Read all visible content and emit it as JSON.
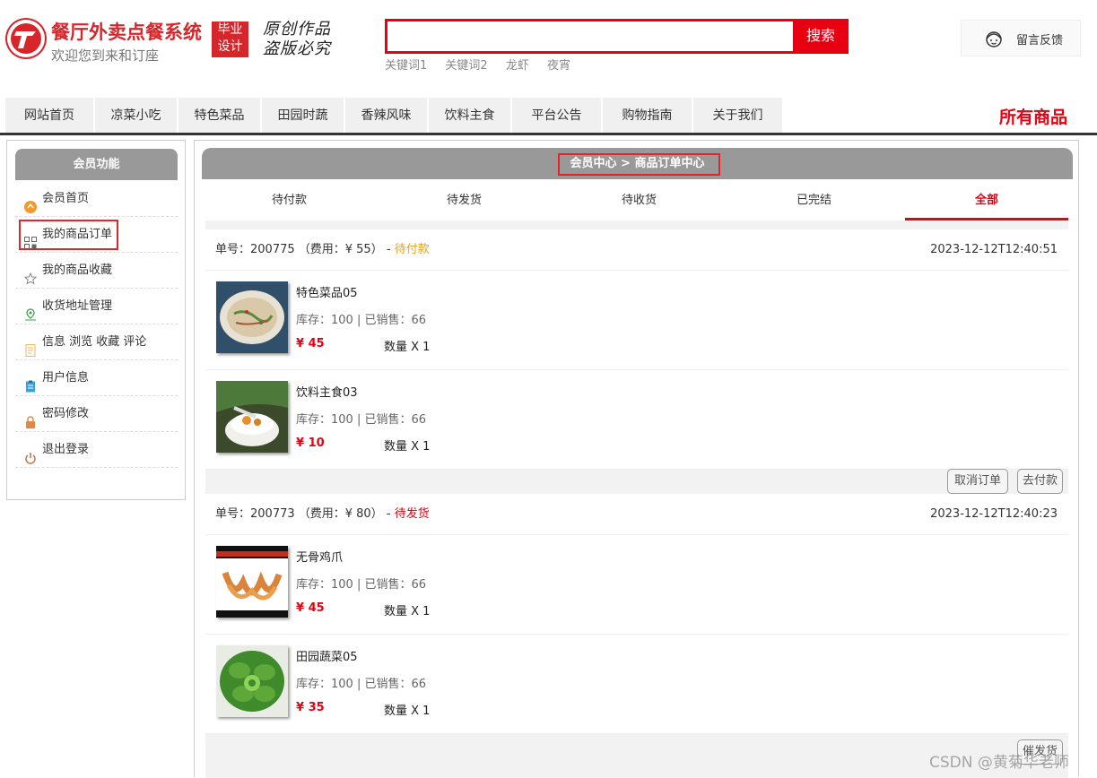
{
  "header": {
    "site_title": "餐厅外卖点餐系统",
    "site_subtitle": "欢迎您到来和订座",
    "badge_line1": "毕业",
    "badge_line2": "设计",
    "seal_line1": "原创作品",
    "seal_line2": "盗版必究",
    "search_placeholder": "",
    "search_button": "搜索",
    "keywords": [
      "关键词1",
      "关键词2",
      "龙虾",
      "夜宵"
    ],
    "feedback_label": "留言反馈"
  },
  "nav": {
    "items": [
      "网站首页",
      "凉菜小吃",
      "特色菜品",
      "田园时蔬",
      "香辣风味",
      "饮料主食",
      "平台公告",
      "购物指南",
      "关于我们"
    ],
    "all_goods": "所有商品"
  },
  "sidebar": {
    "title": "会员功能",
    "items": [
      {
        "label": "会员首页",
        "icon": "member-home-icon",
        "color": "#f39a2a"
      },
      {
        "label": "我的商品订单",
        "icon": "order-grid-icon",
        "color": "#666666"
      },
      {
        "label": "我的商品收藏",
        "icon": "star-icon",
        "color": "#888888"
      },
      {
        "label": "收货地址管理",
        "icon": "location-icon",
        "color": "#3aa34a"
      },
      {
        "label": "信息 浏览 收藏 评论",
        "icon": "document-icon",
        "color": "#f0b860"
      },
      {
        "label": "用户信息",
        "icon": "clipboard-icon",
        "color": "#3aa0d8"
      },
      {
        "label": "密码修改",
        "icon": "lock-icon",
        "color": "#e0874a"
      },
      {
        "label": "退出登录",
        "icon": "power-icon",
        "color": "#c07a5a"
      }
    ]
  },
  "main": {
    "breadcrumb": "会员中心 > 商品订单中心",
    "tabs": [
      "待付款",
      "待发货",
      "待收货",
      "已完结",
      "全部"
    ],
    "active_tab": "全部",
    "orders": [
      {
        "number": "单号：200775 （费用：¥ 55）",
        "sep": " - ",
        "status": "待付款",
        "time": "2023-12-12T12:40:51",
        "items": [
          {
            "name": "特色菜品05",
            "stock": "库存：100 | 已销售：66",
            "price": "¥ 45",
            "qty": "数量 X 1"
          },
          {
            "name": "饮料主食03",
            "stock": "库存：100 | 已销售：66",
            "price": "¥ 10",
            "qty": "数量 X 1"
          }
        ],
        "buttons": [
          "取消订单",
          "去付款"
        ]
      },
      {
        "number": "单号：200773 （费用：¥ 80）",
        "sep": " - ",
        "status": "待发货",
        "time": "2023-12-12T12:40:23",
        "items": [
          {
            "name": "无骨鸡爪",
            "stock": "库存：100 | 已销售：66",
            "price": "¥ 45",
            "qty": "数量 X 1"
          },
          {
            "name": "田园蔬菜05",
            "stock": "库存：100 | 已销售：66",
            "price": "¥ 35",
            "qty": "数量 X 1"
          }
        ],
        "buttons": [
          "催发货"
        ]
      }
    ]
  },
  "watermark": "CSDN @黄菊华老师",
  "colors": {
    "accent": "#e60012",
    "header_gray": "#999999",
    "pending_pay": "#f0a020"
  }
}
